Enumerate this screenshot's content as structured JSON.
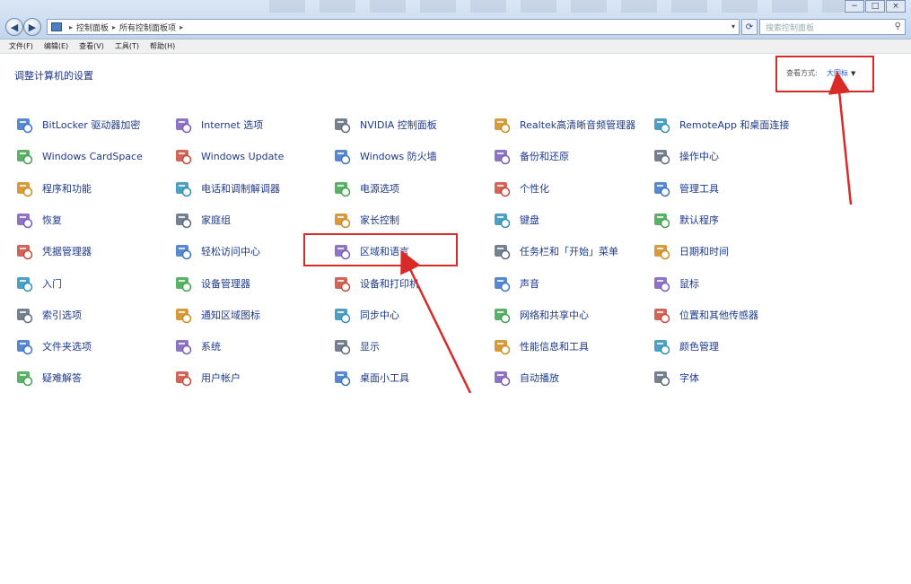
{
  "window": {
    "breadcrumb": [
      "控制面板",
      "所有控制面板项"
    ],
    "search_placeholder": "搜索控制面板",
    "controls": [
      "−",
      "□",
      "×"
    ]
  },
  "menu": [
    "文件(F)",
    "编辑(E)",
    "查看(V)",
    "工具(T)",
    "帮助(H)"
  ],
  "header": {
    "title": "调整计算机的设置",
    "view_mode_label": "查看方式:",
    "view_mode_value": "大图标"
  },
  "columns": [
    [
      "BitLocker 驱动器加密",
      "Windows CardSpace",
      "程序和功能",
      "恢复",
      "凭据管理器",
      "入门",
      "索引选项",
      "文件夹选项",
      "疑难解答"
    ],
    [
      "Internet 选项",
      "Windows Update",
      "电话和调制解调器",
      "家庭组",
      "轻松访问中心",
      "设备管理器",
      "通知区域图标",
      "系统",
      "用户帐户"
    ],
    [
      "NVIDIA 控制面板",
      "Windows 防火墙",
      "电源选项",
      "家长控制",
      "区域和语言",
      "设备和打印机",
      "同步中心",
      "显示",
      "桌面小工具"
    ],
    [
      "Realtek高清晰音频管理器",
      "备份和还原",
      "个性化",
      "键盘",
      "任务栏和「开始」菜单",
      "声音",
      "网络和共享中心",
      "性能信息和工具",
      "自动播放"
    ],
    [
      "RemoteApp 和桌面连接",
      "操作中心",
      "管理工具",
      "默认程序",
      "日期和时间",
      "鼠标",
      "位置和其他传感器",
      "颜色管理",
      "字体"
    ]
  ],
  "icon_colors": [
    "#3b74c7",
    "#3fa34d",
    "#d08a1c",
    "#7a5db8",
    "#c94a3a",
    "#2f8fb8",
    "#5d6b7a"
  ],
  "annotation_color": "#d92a2a"
}
